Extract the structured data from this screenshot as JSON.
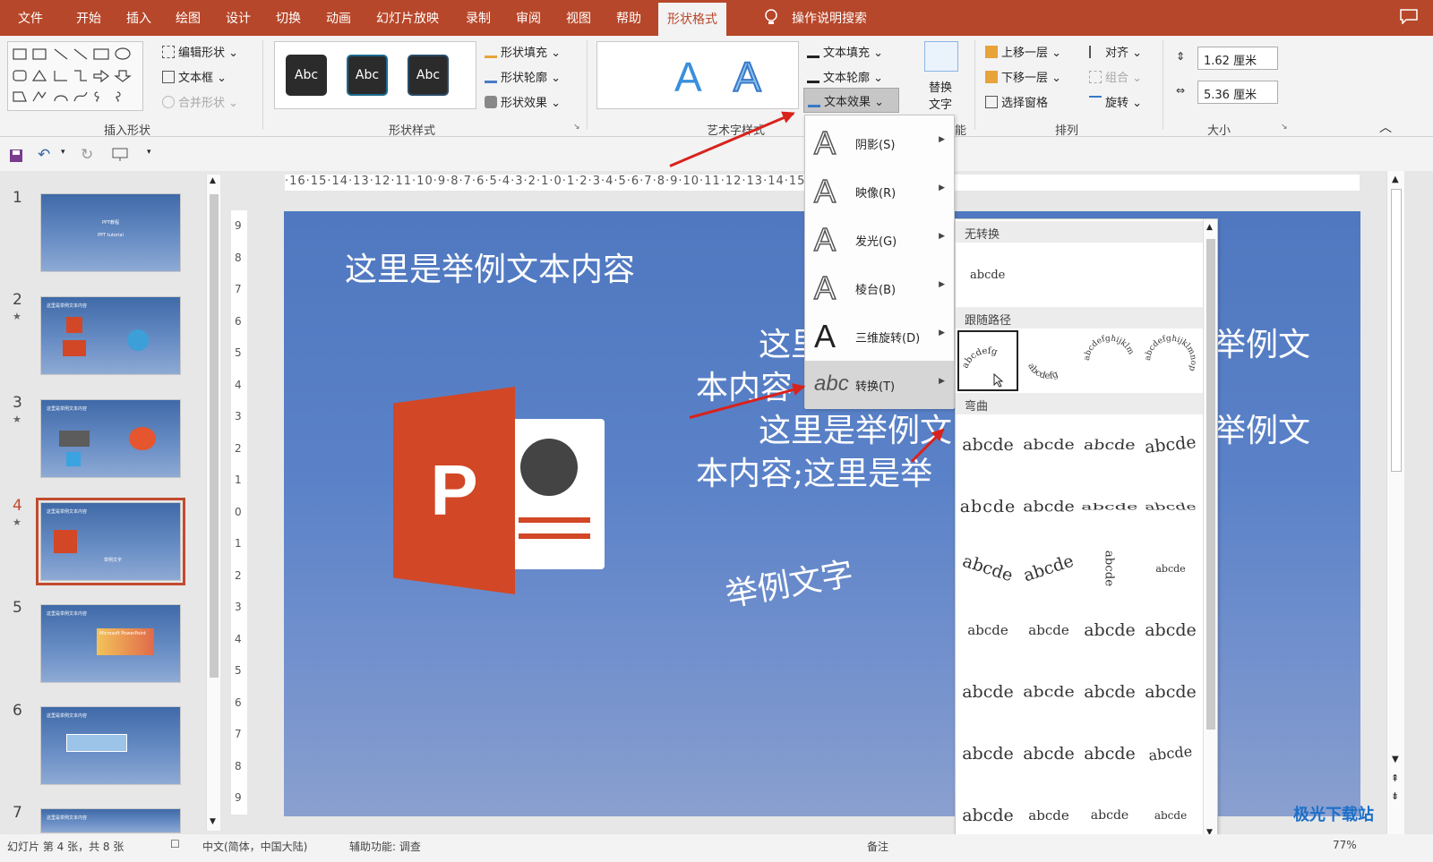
{
  "ribbon_tabs": [
    "文件",
    "开始",
    "插入",
    "绘图",
    "设计",
    "切换",
    "动画",
    "幻灯片放映",
    "录制",
    "审阅",
    "视图",
    "帮助"
  ],
  "active_tab": "形状格式",
  "search_placeholder": "操作说明搜索",
  "insert_shapes": {
    "edit_shape": "编辑形状",
    "text_box": "文本框",
    "merge_shapes": "合并形状",
    "label": "插入形状"
  },
  "shape_styles": {
    "swatch_text": "Abc",
    "fill": "形状填充",
    "outline": "形状轮廓",
    "effects": "形状效果",
    "label": "形状样式"
  },
  "wordart": {
    "big_a": "A",
    "text_fill": "文本填充",
    "text_outline": "文本轮廓",
    "text_effects": "文本效果",
    "label": "艺术字样式"
  },
  "accessibility": {
    "alt_text_line1": "替换",
    "alt_text_line2": "文字",
    "label_fragment": "能"
  },
  "arrange": {
    "bring_forward": "上移一层",
    "send_backward": "下移一层",
    "selection_pane": "选择窗格",
    "align": "对齐",
    "group": "组合",
    "rotate": "旋转",
    "label": "排列"
  },
  "size": {
    "height": "1.62 厘米",
    "width": "5.36 厘米",
    "label": "大小"
  },
  "ruler_h": "·16·15·14·13·12·11·10·9·8·7·6·5·4·3·2·1·0·1·2·3·4·5·6·7·8·9·10·11·12·13·14·15·16·",
  "ruler_v": [
    "9",
    "8",
    "7",
    "6",
    "5",
    "4",
    "3",
    "2",
    "1",
    "0",
    "1",
    "2",
    "3",
    "4",
    "5",
    "6",
    "7",
    "8",
    "9"
  ],
  "slides": [
    {
      "num": "1",
      "star": "",
      "title": "PPT教程",
      "sub": "PPT tutorial"
    },
    {
      "num": "2",
      "star": "★",
      "title": "这里是举例文本内容",
      "sub": ""
    },
    {
      "num": "3",
      "star": "★",
      "title": "这里是举例文本内容",
      "sub": ""
    },
    {
      "num": "4",
      "star": "★",
      "title": "这里是举例文本内容",
      "sub": "举例文字"
    },
    {
      "num": "5",
      "star": "",
      "title": "这里是举例文本内容",
      "sub": "Microsoft PowerPoint"
    },
    {
      "num": "6",
      "star": "",
      "title": "这里是举例文本内容",
      "sub": ""
    },
    {
      "num": "7",
      "star": "",
      "title": "这里是举例文本内容",
      "sub": ""
    }
  ],
  "slide_main": {
    "title": "这里是举例文本内容",
    "line1": "这里是举例文",
    "line1_right": "举例文",
    "line2": "本内容",
    "line3": "这里是举例文",
    "line3_right": "举例文",
    "line4": "本内容;这里是举",
    "curved": "举例文字",
    "logo_letter": "P"
  },
  "text_effects_menu": [
    {
      "label": "阴影(S)",
      "glyph": "A"
    },
    {
      "label": "映像(R)",
      "glyph": "A"
    },
    {
      "label": "发光(G)",
      "glyph": "A"
    },
    {
      "label": "棱台(B)",
      "glyph": "A"
    },
    {
      "label": "三维旋转(D)",
      "glyph": "A"
    },
    {
      "label": "转换(T)",
      "glyph": "abc"
    }
  ],
  "transform_gallery": {
    "no_transform_header": "无转换",
    "no_transform_sample": "abcde",
    "follow_path_header": "跟随路径",
    "follow_path_samples": [
      "abcdefg",
      "abcdefg",
      "abcdefghijklm",
      "abcdefghijklmnop"
    ],
    "warp_header": "弯曲",
    "warp_samples": [
      "abcde",
      "abcde",
      "abcde",
      "abcde",
      "abcde",
      "abcde",
      "abcde",
      "abcde",
      "abcde",
      "abcde",
      "abcde",
      "abcde",
      "abcde",
      "abcde",
      "abcde",
      "abcde",
      "abcde",
      "abcde",
      "abcde",
      "abcde",
      "abcde",
      "abcde",
      "abcde",
      "abcde",
      "abcde",
      "abcde",
      "abcde",
      "abcde"
    ]
  },
  "status": {
    "slide_pos": "幻灯片 第 4 张，共 8 张",
    "lang": "中文(简体，中国大陆)",
    "accessibility": "辅助功能: 调查",
    "notes": "备注",
    "zoom": "77%"
  },
  "watermark": "极光下载站",
  "colors": {
    "accent": "#b7472a",
    "arrow": "#d8231c",
    "slide": "#5b82c8"
  }
}
